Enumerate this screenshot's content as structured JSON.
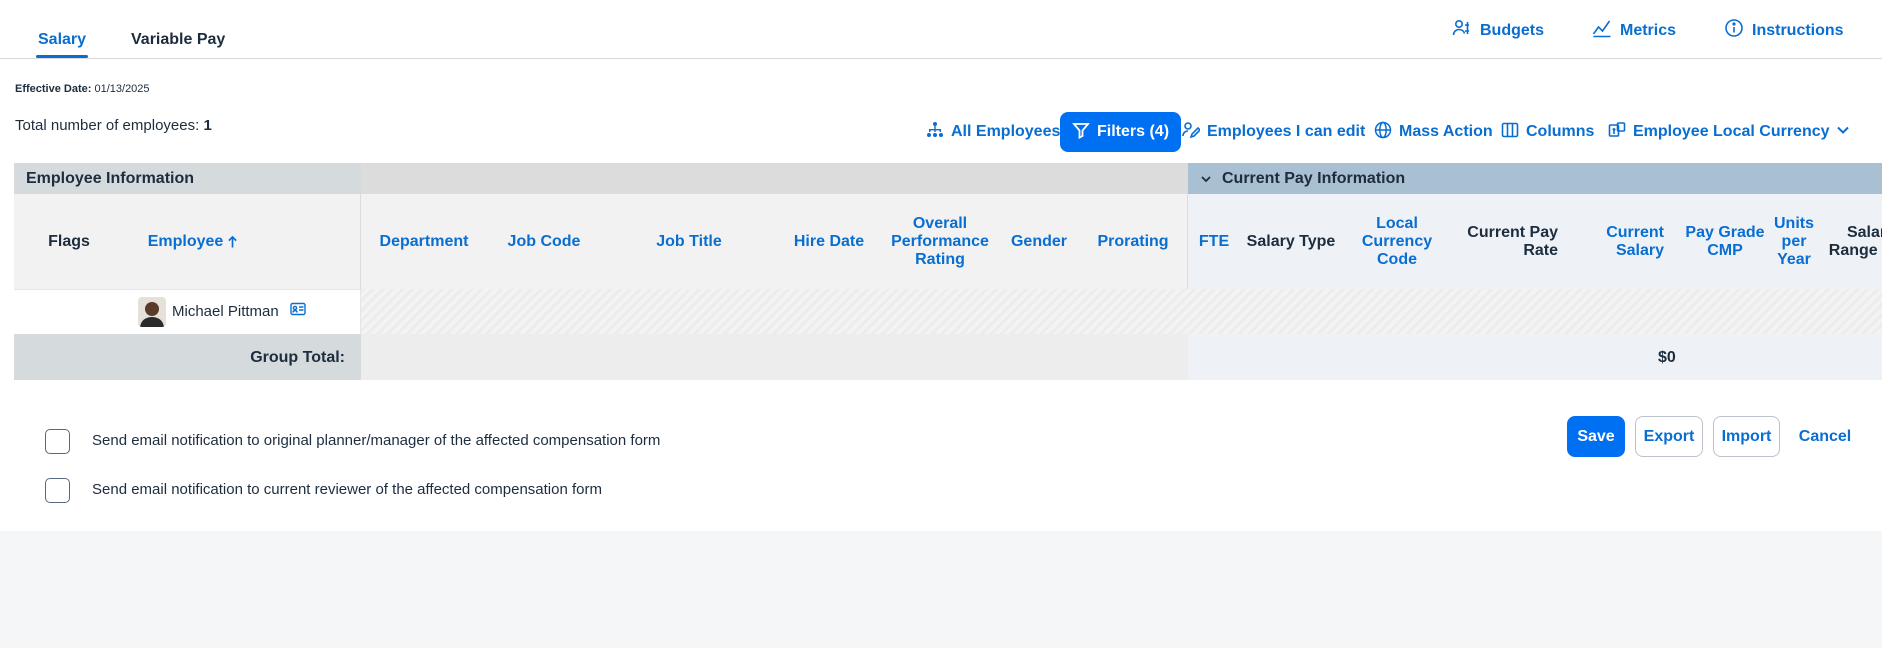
{
  "tabs": {
    "salary": "Salary",
    "variable_pay": "Variable Pay"
  },
  "top_links": {
    "budgets": "Budgets",
    "metrics": "Metrics",
    "instructions": "Instructions"
  },
  "effective": {
    "label": "Effective Date:",
    "value": "01/13/2025"
  },
  "total": {
    "label": "Total number of employees:",
    "value": "1"
  },
  "toolbar": {
    "all_employees": "All Employees",
    "filters": "Filters (4)",
    "employees_edit": "Employees I can edit",
    "mass_action": "Mass Action",
    "columns": "Columns",
    "local_currency": "Employee Local Currency"
  },
  "grid": {
    "band_employee": "Employee Information",
    "band_pay": "Current Pay Information",
    "columns": {
      "flags": "Flags",
      "employee": "Employee",
      "department": "Department",
      "job_code": "Job Code",
      "job_title": "Job Title",
      "hire_date": "Hire Date",
      "overall_rating": "Overall Performance Rating",
      "gender": "Gender",
      "prorating": "Prorating",
      "fte": "FTE",
      "salary_type": "Salary Type",
      "local_currency_code": "Local Currency Code",
      "current_pay_rate": "Current Pay Rate",
      "current_salary": "Current Salary",
      "pay_grade_cmp": "Pay Grade CMP",
      "units_per_year": "Units per Year",
      "salary_range_max": "Salary Range Max"
    },
    "row": {
      "employee_name": "Michael Pittman"
    },
    "group_total": {
      "label": "Group Total:",
      "current_salary": "$0"
    }
  },
  "notifications": {
    "original_planner": "Send email notification to original planner/manager of the affected compensation form",
    "current_reviewer": "Send email notification to current reviewer of the affected compensation form"
  },
  "actions": {
    "save": "Save",
    "export": "Export",
    "import": "Import",
    "cancel": "Cancel"
  },
  "colors": {
    "accent": "#0a6ed1",
    "primary_button": "#0070f2",
    "band_pay": "#a9bfd2",
    "band_employee": "#d5dadd"
  }
}
